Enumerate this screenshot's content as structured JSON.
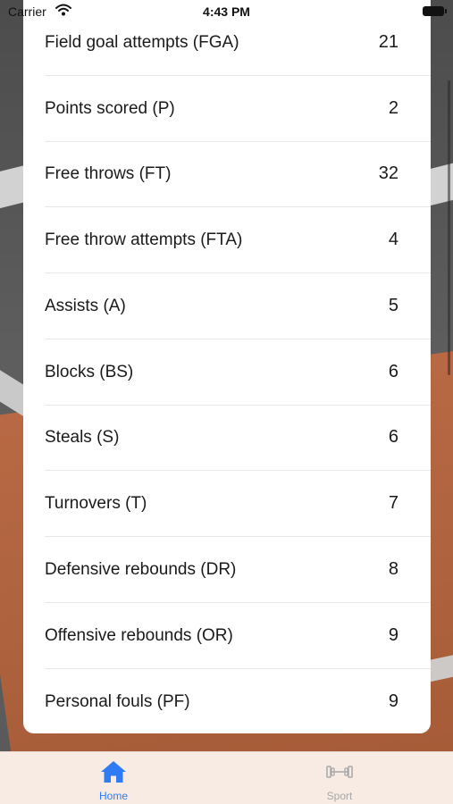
{
  "status_bar": {
    "carrier": "Carrier",
    "time": "4:43 PM"
  },
  "stats": [
    {
      "label": "Field goal attempts (FGA)",
      "value": "21"
    },
    {
      "label": "Points scored (P)",
      "value": "2"
    },
    {
      "label": "Free throws (FT)",
      "value": "32"
    },
    {
      "label": "Free throw attempts (FTA)",
      "value": "4"
    },
    {
      "label": "Assists (A)",
      "value": "5"
    },
    {
      "label": "Blocks (BS)",
      "value": "6"
    },
    {
      "label": "Steals (S)",
      "value": "6"
    },
    {
      "label": "Turnovers (T)",
      "value": "7"
    },
    {
      "label": "Defensive rebounds (DR)",
      "value": "8"
    },
    {
      "label": "Offensive rebounds (OR)",
      "value": "9"
    },
    {
      "label": "Personal fouls (PF)",
      "value": "9"
    }
  ],
  "tab_bar": {
    "home": {
      "label": "Home",
      "icon": "house-icon",
      "selected": true,
      "color": "#2f7bf6"
    },
    "sport": {
      "label": "Sport",
      "icon": "dumbbell-icon",
      "selected": false,
      "color": "#a7a7a7"
    }
  }
}
